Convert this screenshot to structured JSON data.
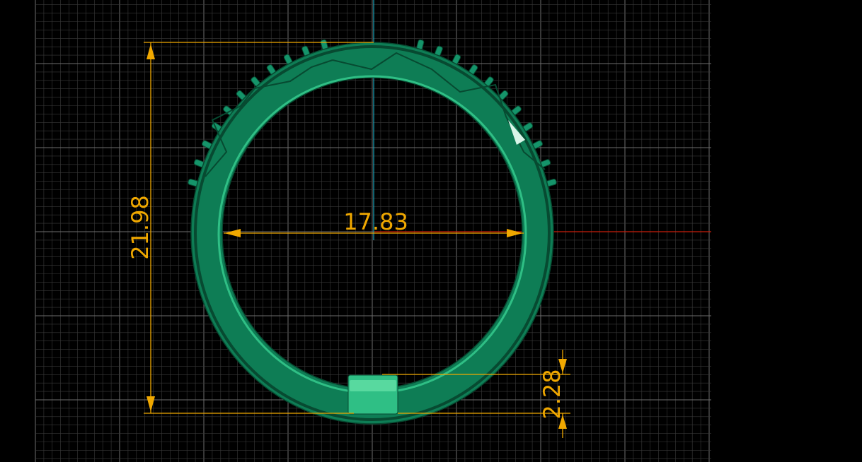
{
  "viewport": {
    "name": "cad-viewport",
    "background_color": "#000000",
    "grid_minor_color": "#3a3a3a",
    "grid_major_color": "#6e6e6e",
    "axis_x_color": "#c81e0a",
    "axis_y_color": "#1aa3b8"
  },
  "model": {
    "name": "ring-band",
    "body_color": "#0e7d55",
    "highlight_color": "#2fbf85",
    "shadow_color": "#074a31",
    "bead_color": "#15946a"
  },
  "dimensions": {
    "color": "#f0a800",
    "height_label": "21.98",
    "inner_diameter_label": "17.83",
    "shank_thickness_label": "2.28"
  }
}
